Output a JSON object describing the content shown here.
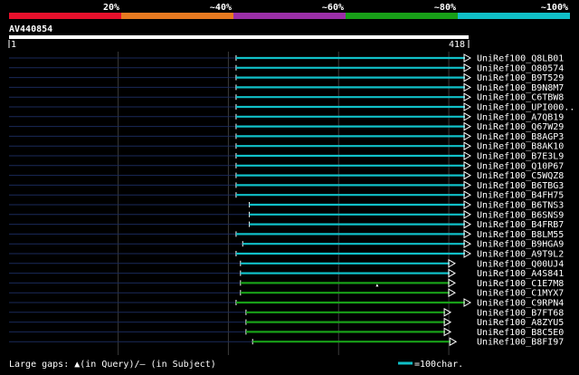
{
  "query_id": "AV440854",
  "scale_start": "1",
  "scale_end": "418",
  "identity_legend": [
    {
      "label": "20%",
      "color": "#e8102c"
    },
    {
      "label": "~40%",
      "color": "#e87a20"
    },
    {
      "label": "~60%",
      "color": "#9b2fa8"
    },
    {
      "label": "~80%",
      "color": "#18a018"
    },
    {
      "label": "~100%",
      "color": "#10c0c8"
    }
  ],
  "footer": {
    "gaps_label": "Large gaps: ▲(in Query)/― (in Subject)",
    "scale_label": "=100char."
  },
  "chart_data": {
    "type": "alignment_map",
    "query_length": 418,
    "hits": [
      {
        "id": "UniRef100_Q8LB01",
        "q_start": 207,
        "q_end": 418,
        "identity": "~100%",
        "arrow": "right"
      },
      {
        "id": "UniRef100_O80574",
        "q_start": 207,
        "q_end": 418,
        "identity": "~100%",
        "arrow": "right"
      },
      {
        "id": "UniRef100_B9T529",
        "q_start": 207,
        "q_end": 418,
        "identity": "~100%",
        "arrow": "right"
      },
      {
        "id": "UniRef100_B9N8M7",
        "q_start": 207,
        "q_end": 418,
        "identity": "~100%",
        "arrow": "right"
      },
      {
        "id": "UniRef100_C6TBW8",
        "q_start": 207,
        "q_end": 418,
        "identity": "~100%",
        "arrow": "right"
      },
      {
        "id": "UniRef100_UPI000..",
        "q_start": 207,
        "q_end": 418,
        "identity": "~100%",
        "arrow": "right"
      },
      {
        "id": "UniRef100_A7QB19",
        "q_start": 207,
        "q_end": 418,
        "identity": "~100%",
        "arrow": "right"
      },
      {
        "id": "UniRef100_Q67W29",
        "q_start": 207,
        "q_end": 418,
        "identity": "~100%",
        "arrow": "right"
      },
      {
        "id": "UniRef100_B8AGP3",
        "q_start": 207,
        "q_end": 418,
        "identity": "~100%",
        "arrow": "right"
      },
      {
        "id": "UniRef100_B8AK10",
        "q_start": 207,
        "q_end": 418,
        "identity": "~100%",
        "arrow": "right"
      },
      {
        "id": "UniRef100_B7E3L9",
        "q_start": 207,
        "q_end": 418,
        "identity": "~100%",
        "arrow": "right"
      },
      {
        "id": "UniRef100_Q10P67",
        "q_start": 207,
        "q_end": 418,
        "identity": "~100%",
        "arrow": "right"
      },
      {
        "id": "UniRef100_C5WQZ8",
        "q_start": 207,
        "q_end": 418,
        "identity": "~100%",
        "arrow": "right"
      },
      {
        "id": "UniRef100_B6TBG3",
        "q_start": 207,
        "q_end": 418,
        "identity": "~100%",
        "arrow": "right"
      },
      {
        "id": "UniRef100_B4FH75",
        "q_start": 207,
        "q_end": 418,
        "identity": "~100%",
        "arrow": "right"
      },
      {
        "id": "UniRef100_B6TNS3",
        "q_start": 219,
        "q_end": 418,
        "identity": "~100%",
        "arrow": "right"
      },
      {
        "id": "UniRef100_B6SNS9",
        "q_start": 219,
        "q_end": 418,
        "identity": "~100%",
        "arrow": "right"
      },
      {
        "id": "UniRef100_B4FRB7",
        "q_start": 219,
        "q_end": 418,
        "identity": "~100%",
        "arrow": "right"
      },
      {
        "id": "UniRef100_B8LM55",
        "q_start": 207,
        "q_end": 418,
        "identity": "~100%",
        "arrow": "right"
      },
      {
        "id": "UniRef100_B9HGA9",
        "q_start": 213,
        "q_end": 418,
        "identity": "~100%",
        "arrow": "right"
      },
      {
        "id": "UniRef100_A9T9L2",
        "q_start": 207,
        "q_end": 418,
        "identity": "~100%",
        "arrow": "right"
      },
      {
        "id": "UniRef100_Q00UJ4",
        "q_start": 211,
        "q_end": 404,
        "identity": "~100%",
        "arrow": "right"
      },
      {
        "id": "UniRef100_A4S841",
        "q_start": 211,
        "q_end": 404,
        "identity": "~100%",
        "arrow": "right"
      },
      {
        "id": "UniRef100_C1E7M8",
        "q_start": 211,
        "q_end": 404,
        "identity": "~80%",
        "arrow": "right",
        "gap_in_query_at": 335
      },
      {
        "id": "UniRef100_C1MYX7",
        "q_start": 211,
        "q_end": 404,
        "identity": "~80%",
        "arrow": "right"
      },
      {
        "id": "UniRef100_C9RPN4",
        "q_start": 207,
        "q_end": 418,
        "identity": "~80%",
        "arrow": "right"
      },
      {
        "id": "UniRef100_B7FT68",
        "q_start": 216,
        "q_end": 400,
        "identity": "~80%",
        "arrow": "right"
      },
      {
        "id": "UniRef100_A8ZYU5",
        "q_start": 216,
        "q_end": 400,
        "identity": "~80%",
        "arrow": "right"
      },
      {
        "id": "UniRef100_B8C5E0",
        "q_start": 216,
        "q_end": 400,
        "identity": "~80%",
        "arrow": "right"
      },
      {
        "id": "UniRef100_B8FI97",
        "q_start": 222,
        "q_end": 405,
        "identity": "~80%",
        "arrow": "right"
      }
    ]
  }
}
